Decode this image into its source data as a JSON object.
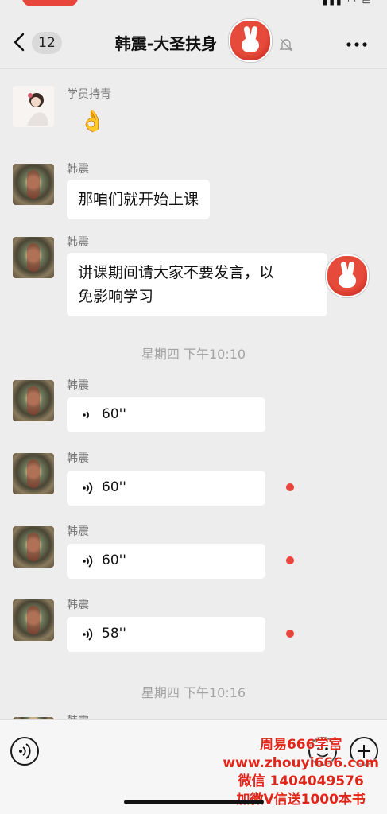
{
  "header": {
    "unread_count": "12",
    "title": "韩震-大圣扶身",
    "title_suffix": ")"
  },
  "messages": [
    {
      "sender": "学员持青",
      "content": "👌"
    },
    {
      "sender": "韩震",
      "content": "那咱们就开始上课"
    },
    {
      "sender": "韩震",
      "content_line1": "讲课期间请大家不要发言，以",
      "content_line2": "免影响学习"
    }
  ],
  "timestamps": [
    "星期四 下午10:10",
    "星期四 下午10:16"
  ],
  "voice_messages": [
    {
      "sender": "韩震",
      "duration": "60''",
      "unread": false
    },
    {
      "sender": "韩震",
      "duration": "60''",
      "unread": true
    },
    {
      "sender": "韩震",
      "duration": "60''",
      "unread": true
    },
    {
      "sender": "韩震",
      "duration": "58''",
      "unread": true
    }
  ],
  "partial_sender": "韩震",
  "watermark": {
    "line1": "周易666学宫",
    "line2": "www.zhouyi666.com",
    "line3": "微信 1404049576",
    "line4": "加微V信送1000本书"
  },
  "colors": {
    "background": "#ededed",
    "bubble": "#ffffff",
    "unread_dot": "#e8453c",
    "watermark": "#e0261b"
  },
  "icons": [
    "back-icon",
    "mute-icon",
    "more-icon",
    "voice-icon",
    "voice-input-icon",
    "emoji-icon",
    "plus-icon"
  ]
}
